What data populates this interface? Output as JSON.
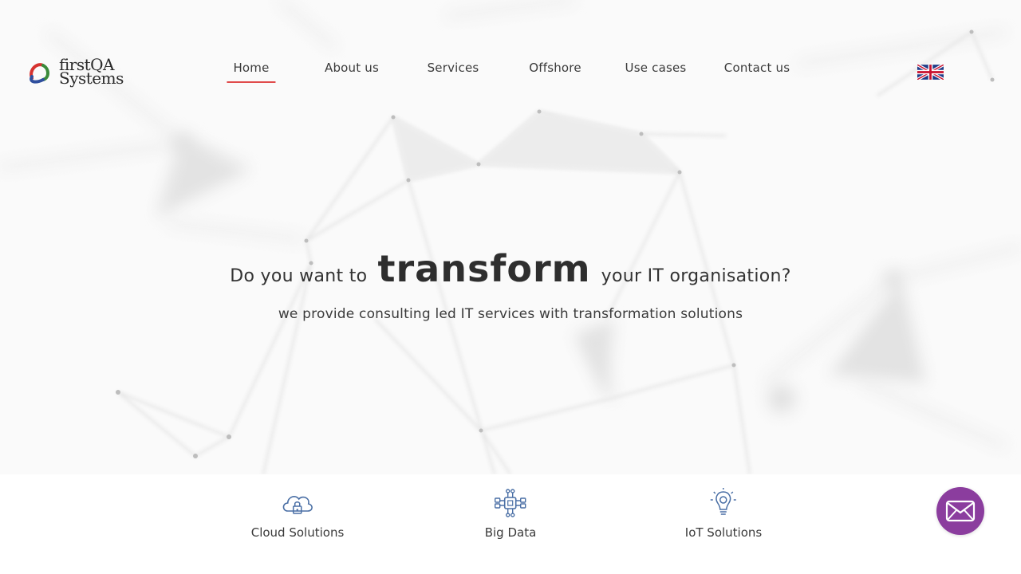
{
  "brand": {
    "line1": "firstQA",
    "line2": "Systems",
    "colors": {
      "red": "#d6322f",
      "green": "#3a8a3a",
      "blue": "#2f4f9e"
    }
  },
  "nav": {
    "items": [
      {
        "label": "Home",
        "active": true
      },
      {
        "label": "About us",
        "active": false
      },
      {
        "label": "Services",
        "active": false
      },
      {
        "label": "Offshore",
        "active": false
      },
      {
        "label": "Use cases",
        "active": false
      },
      {
        "label": "Contact us",
        "active": false
      }
    ],
    "active_underline_color": "#e04b4b"
  },
  "language": {
    "icon": "uk-flag-icon"
  },
  "hero": {
    "headline_before": "Do you want to",
    "headline_emphasis": "transform",
    "headline_after": "your IT organisation?",
    "subline": "we provide consulting led IT services with transformation solutions"
  },
  "features": [
    {
      "label": "Cloud Solutions",
      "icon": "cloud-lock-icon"
    },
    {
      "label": "Big Data",
      "icon": "network-chip-icon"
    },
    {
      "label": "IoT Solutions",
      "icon": "lightbulb-icon"
    }
  ],
  "contact_fab": {
    "icon": "envelope-icon",
    "color": "#8b3d9e"
  },
  "icon_color": "#4a6fa5"
}
